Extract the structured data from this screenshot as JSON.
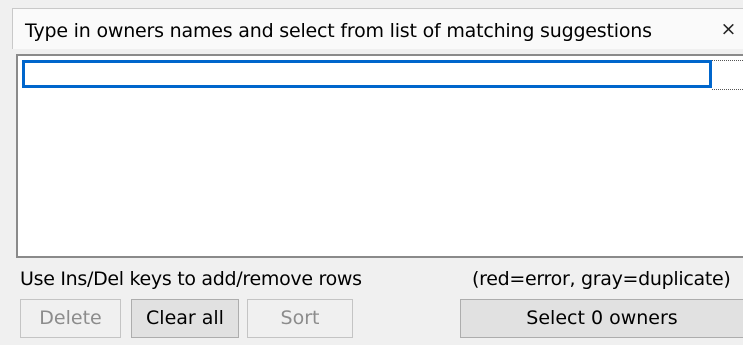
{
  "header": {
    "title": "Type in owners names and select from list of matching suggestions",
    "close_label": "×"
  },
  "list": {
    "rows": [
      {
        "value": ""
      }
    ]
  },
  "hints": {
    "keys": "Use Ins/Del keys to add/remove rows",
    "legend": "(red=error, gray=duplicate)"
  },
  "buttons": {
    "delete_label": "Delete",
    "delete_enabled": false,
    "clear_all_label": "Clear all",
    "clear_all_enabled": true,
    "sort_label": "Sort",
    "sort_enabled": false,
    "select_label": "Select 0 owners",
    "select_enabled": true
  },
  "colors": {
    "focus_border": "#0066cc",
    "window_bg": "#f0f0f0",
    "list_bg": "#ffffff"
  }
}
